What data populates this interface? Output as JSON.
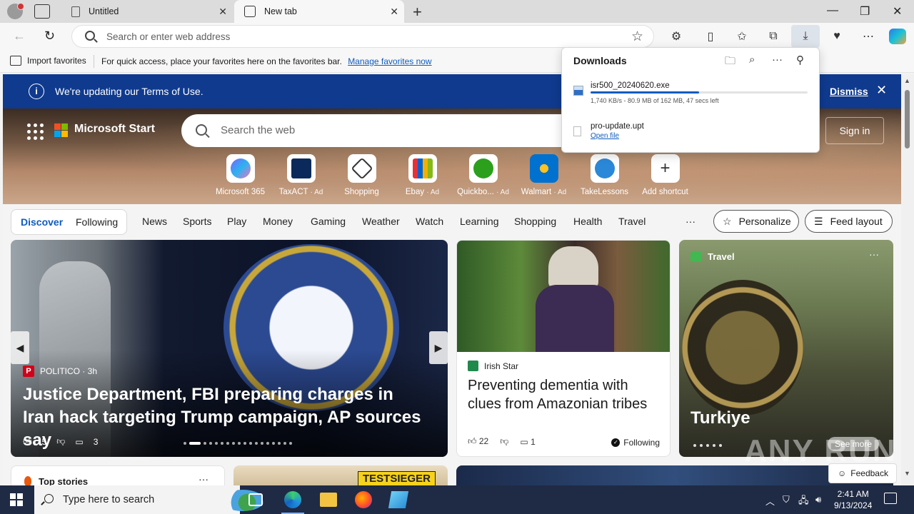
{
  "browser": {
    "tabs": [
      {
        "title": "Untitled",
        "active": false
      },
      {
        "title": "New tab",
        "active": true
      }
    ],
    "address_placeholder": "Search or enter web address"
  },
  "favorites_bar": {
    "import_label": "Import favorites",
    "message": "For quick access, place your favorites here on the favorites bar.",
    "link": "Manage favorites now"
  },
  "banner": {
    "text": "We're updating our Terms of Use.",
    "dismiss": "Dismiss"
  },
  "start": {
    "brand": "Microsoft Start",
    "search_placeholder": "Search the web",
    "sign_in": "Sign in",
    "shortcuts": [
      {
        "label": "Microsoft 365",
        "ad": "",
        "color": "#7b61ff"
      },
      {
        "label": "TaxACT",
        "ad": "· Ad",
        "color": "#0b2a5b"
      },
      {
        "label": "Shopping",
        "ad": "",
        "color": "#333333"
      },
      {
        "label": "Ebay",
        "ad": "· Ad",
        "color": "#e53238"
      },
      {
        "label": "Quickbo...",
        "ad": "· Ad",
        "color": "#2ca01c"
      },
      {
        "label": "Walmart",
        "ad": "· Ad",
        "color": "#0071ce"
      },
      {
        "label": "TakeLessons",
        "ad": "",
        "color": "#2b88d8"
      },
      {
        "label": "Add shortcut",
        "ad": "",
        "color": "#ffffff"
      }
    ]
  },
  "feed_nav": {
    "discover": "Discover",
    "following": "Following",
    "categories": [
      "News",
      "Sports",
      "Play",
      "Money",
      "Gaming",
      "Weather",
      "Watch",
      "Learning",
      "Shopping",
      "Health",
      "Travel"
    ],
    "more": "···",
    "personalize": "Personalize",
    "feed_layout": "Feed layout"
  },
  "cards": {
    "main": {
      "source": "POLITICO · 3h",
      "headline": "Justice Department, FBI preparing charges in Iran hack targeting Trump campaign, AP sources say",
      "likes": "5",
      "comments": "3"
    },
    "second": {
      "source": "Irish Star",
      "headline": "Preventing dementia with clues from Amazonian tribes",
      "likes": "22",
      "comments": "1",
      "following": "Following"
    },
    "third": {
      "tag": "Travel",
      "title": "Turkiye",
      "see_more": "See more",
      "more": "···"
    },
    "row2": {
      "top_stories": "Top stories",
      "badge": "TESTSIEGER"
    },
    "feedback": "Feedback"
  },
  "downloads": {
    "title": "Downloads",
    "items": [
      {
        "name": "isr500_20240620.exe",
        "status": "1,740 KB/s - 80.9 MB of 162 MB, 47 secs left",
        "progress": 0.5
      },
      {
        "name": "pro-update.upt",
        "action": "Open file"
      }
    ]
  },
  "taskbar": {
    "search_placeholder": "Type here to search",
    "time": "2:41 AM",
    "date": "9/13/2024"
  },
  "watermark": "ANY RUN"
}
